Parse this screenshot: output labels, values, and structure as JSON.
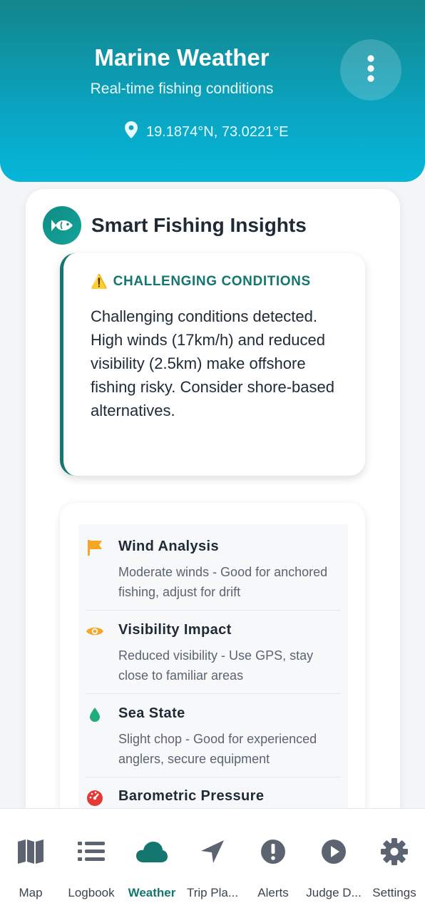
{
  "header": {
    "title": "Marine Weather",
    "subtitle": "Real-time fishing conditions",
    "coordinates": "19.1874°N, 73.0221°E",
    "menu_icon": "more-vertical-icon",
    "location_icon": "location-pin-icon"
  },
  "insights": {
    "title": "Smart Fishing Insights",
    "icon": "fish-icon",
    "alert": {
      "icon": "⚠️",
      "title": "CHALLENGING CONDITIONS",
      "text": "Challenging conditions detected. High winds (17km/h) and reduced visibility (2.5km) make offshore fishing risky. Consider shore-based alternatives."
    },
    "analysis": [
      {
        "icon": "flag-icon",
        "title": "Wind Analysis",
        "desc": "Moderate winds - Good for anchored fishing, adjust for drift"
      },
      {
        "icon": "eye-icon",
        "title": "Visibility Impact",
        "desc": "Reduced visibility - Use GPS, stay close to familiar areas"
      },
      {
        "icon": "water-drop-icon",
        "title": "Sea State",
        "desc": "Slight chop - Good for experienced anglers, secure equipment"
      },
      {
        "icon": "gauge-icon",
        "title": "Barometric Pressure",
        "desc": ""
      }
    ]
  },
  "nav": {
    "active": "Weather",
    "items": [
      {
        "label": "Map",
        "icon": "map-icon"
      },
      {
        "label": "Logbook",
        "icon": "list-icon"
      },
      {
        "label": "Weather",
        "icon": "cloud-icon"
      },
      {
        "label": "Trip Pla...",
        "icon": "navigation-arrow-icon"
      },
      {
        "label": "Alerts",
        "icon": "alert-circle-icon"
      },
      {
        "label": "Judge D...",
        "icon": "play-circle-icon"
      },
      {
        "label": "Settings",
        "icon": "gear-icon"
      }
    ]
  },
  "colors": {
    "accent": "#13766f",
    "header_top": "#13858b",
    "header_bottom": "#06b6d8",
    "wind_icon": "#f5a623",
    "visibility_icon": "#f5a623",
    "sea_icon": "#1fae7a",
    "pressure_icon": "#e53935",
    "nav_icon": "#5b6470"
  }
}
